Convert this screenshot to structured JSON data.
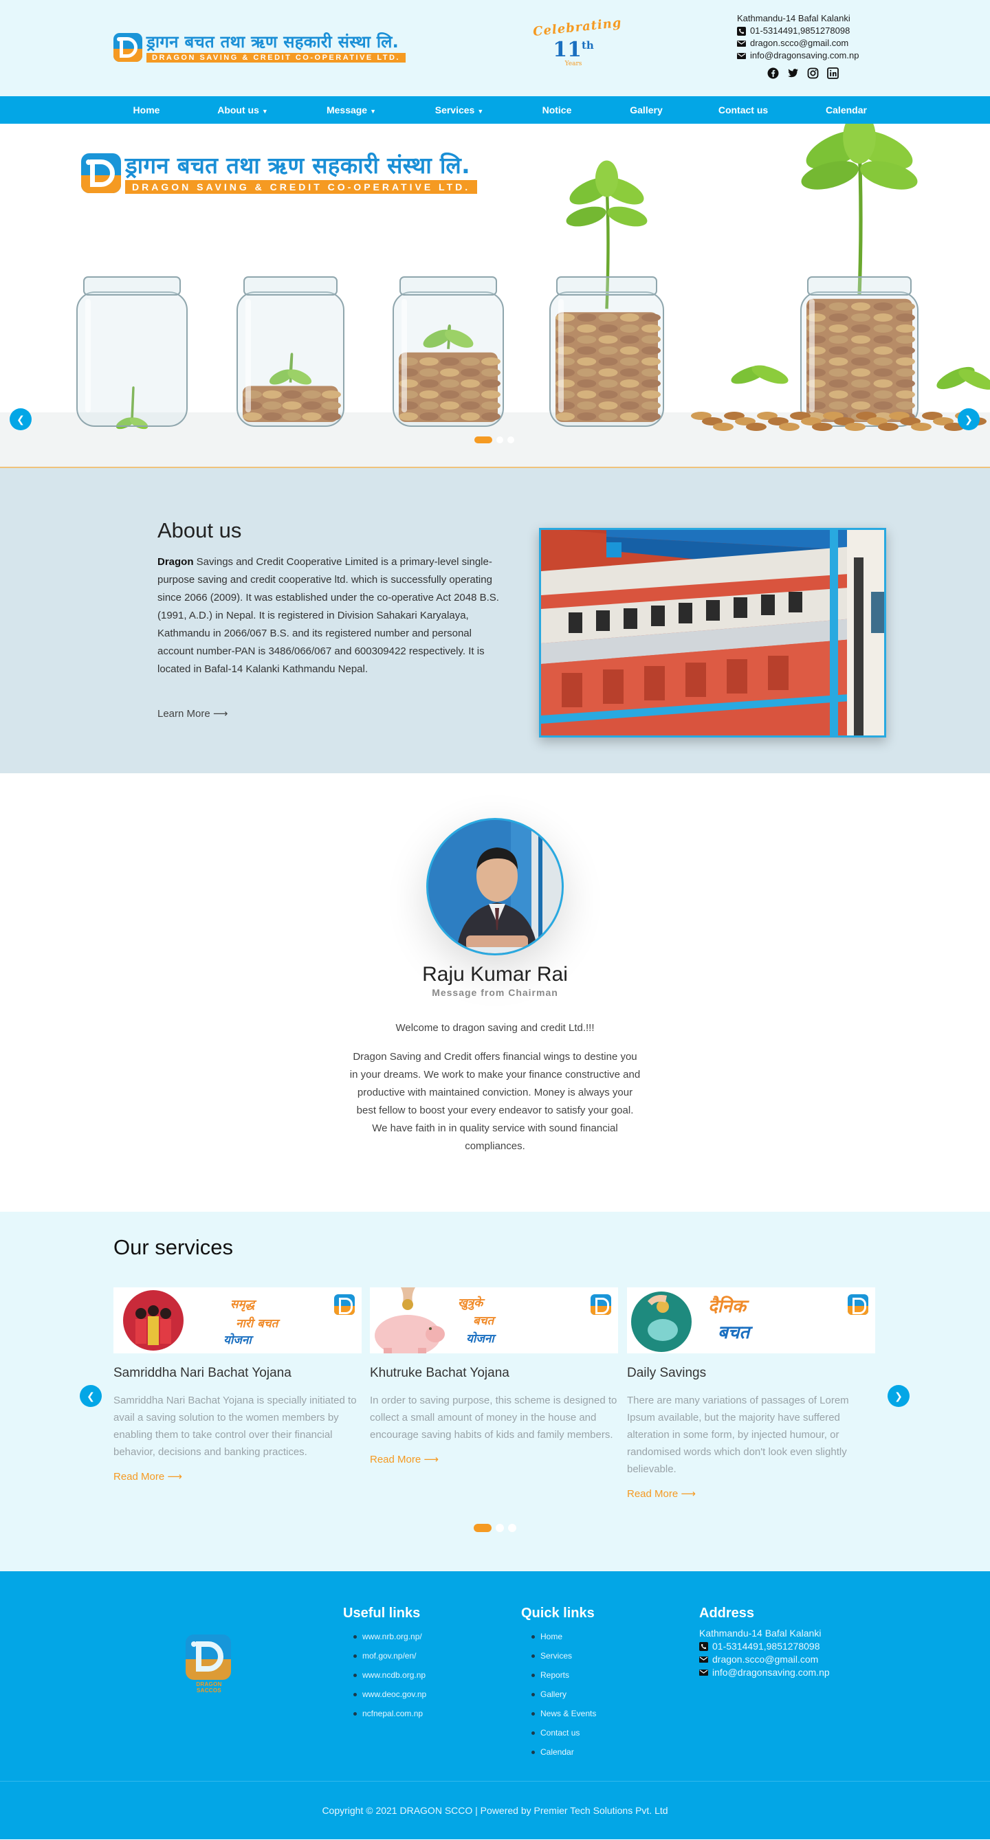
{
  "brand": {
    "name_np": "ड्रागन बचत तथा ऋण सहकारी संस्था लि.",
    "name_en": "DRAGON SAVING & CREDIT CO-OPERATIVE LTD.",
    "footer_caption": "DRAGON SACCOS"
  },
  "celebration": {
    "word": "Celebrating",
    "number": "11",
    "suffix": "th",
    "unit": "Years"
  },
  "top_contact": {
    "address": "Kathmandu-14 Bafal Kalanki",
    "phone": "01-5314491,9851278098",
    "email1": "dragon.scco@gmail.com",
    "email2": "info@dragonsaving.com.np"
  },
  "social_icons": [
    "facebook-icon",
    "twitter-icon",
    "instagram-icon",
    "linkedin-icon"
  ],
  "nav": [
    {
      "label": "Home",
      "dropdown": false
    },
    {
      "label": "About us",
      "dropdown": true
    },
    {
      "label": "Message",
      "dropdown": true
    },
    {
      "label": "Services",
      "dropdown": true
    },
    {
      "label": "Notice",
      "dropdown": false
    },
    {
      "label": "Gallery",
      "dropdown": false
    },
    {
      "label": "Contact us",
      "dropdown": false
    },
    {
      "label": "Calendar",
      "dropdown": false
    }
  ],
  "hero": {
    "prev_icon": "chevron-left-icon",
    "next_icon": "chevron-right-icon"
  },
  "about": {
    "heading": "About us",
    "lead": "Dragon",
    "body": " Savings and Credit Cooperative Limited is a primary-level single-purpose saving and credit cooperative ltd. which is successfully operating since 2066 (2009). It was established under the co-operative Act 2048 B.S. (1991, A.D.) in Nepal. It is registered in Division Sahakari Karyalaya, Kathmandu in 2066/067 B.S. and its registered number and personal account number-PAN is 3486/066/067 and 600309422 respectively. It is located in Bafal-14 Kalanki Kathmandu Nepal.",
    "learn_more": "Learn More"
  },
  "chairman": {
    "name": "Raju Kumar Rai",
    "role": "Message from Chairman",
    "welcome": "Welcome to dragon saving and credit Ltd.!!!",
    "message": "Dragon Saving and Credit offers financial wings to destine you in your dreams. We work to make your finance constructive and productive with maintained conviction. Money is always your best fellow to boost your every endeavor to satisfy your goal. We have faith in in quality service with sound financial compliances."
  },
  "services": {
    "heading": "Our services",
    "items": [
      {
        "title": "Samriddha Nari Bachat Yojana",
        "banner_lines": [
          "समृद्ध",
          "नारी बचत",
          "योजना"
        ],
        "text": "Samriddha Nari Bachat Yojana is specially initiated to avail a saving solution to the women members by enabling them to take control over their financial behavior, decisions and banking practices.",
        "more": "Read More"
      },
      {
        "title": "Khutruke Bachat Yojana",
        "banner_lines": [
          "खुत्रुके",
          "बचत",
          "योजना"
        ],
        "text": "In order to saving purpose, this scheme is designed to collect a small amount of money in the house and encourage saving habits of kids and family members.",
        "more": "Read More"
      },
      {
        "title": "Daily Savings",
        "banner_lines": [
          "दैनिक",
          "बचत"
        ],
        "text": "There are many variations of passages of Lorem Ipsum available, but the majority have suffered alteration in some form, by injected humour, or randomised words which don't look even slightly believable.",
        "more": "Read More"
      }
    ],
    "dot_count": 3,
    "active_dot": 0
  },
  "footer": {
    "useful": {
      "heading": "Useful links",
      "links": [
        "www.nrb.org.np/",
        "mof.gov.np/en/",
        "www.ncdb.org.np",
        "www.deoc.gov.np",
        "ncfnepal.com.np"
      ]
    },
    "quick": {
      "heading": "Quick links",
      "links": [
        "Home",
        "Services",
        "Reports",
        "Gallery",
        "News & Events",
        "Contact us",
        "Calendar"
      ]
    },
    "address": {
      "heading": "Address",
      "line": "Kathmandu-14 Bafal Kalanki",
      "phone": "01-5314491,9851278098",
      "email1": "dragon.scco@gmail.com",
      "email2": "info@dragonsaving.com.np"
    },
    "copyright": "Copyright © 2021 DRAGON SCCO | Powered by Premier Tech Solutions Pvt. Ltd"
  },
  "colors": {
    "primary": "#03a6e6",
    "accent": "#f59a22",
    "header_bg": "#e6f8fc",
    "about_bg": "#d6e5ec"
  }
}
